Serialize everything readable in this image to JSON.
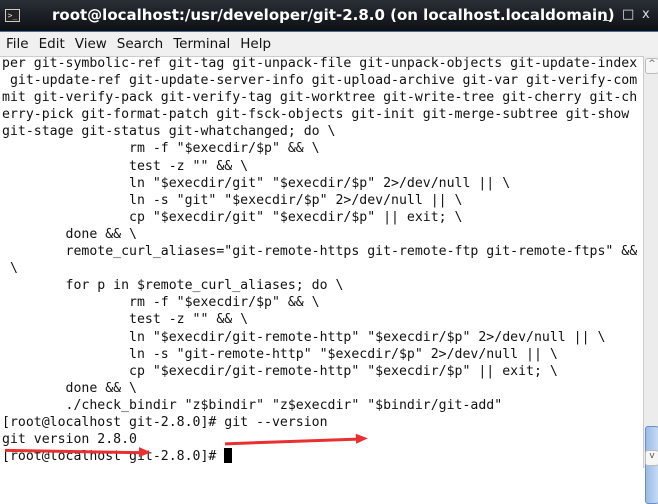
{
  "window": {
    "title": "root@localhost:/usr/developer/git-2.8.0 (on localhost.localdomain)",
    "icon": "terminal-icon",
    "controls": {
      "minimize": "_",
      "maximize": "□",
      "close": "x"
    }
  },
  "menu": [
    "File",
    "Edit",
    "View",
    "Search",
    "Terminal",
    "Help"
  ],
  "terminal": {
    "lines": [
      "per git-symbolic-ref git-tag git-unpack-file git-unpack-objects git-update-index",
      " git-update-ref git-update-server-info git-upload-archive git-var git-verify-com",
      "mit git-verify-pack git-verify-tag git-worktree git-write-tree git-cherry git-ch",
      "erry-pick git-format-patch git-fsck-objects git-init git-merge-subtree git-show",
      "git-stage git-status git-whatchanged; do \\",
      "                rm -f \"$execdir/$p\" && \\",
      "                test -z \"\" && \\",
      "                ln \"$execdir/git\" \"$execdir/$p\" 2>/dev/null || \\",
      "                ln -s \"git\" \"$execdir/$p\" 2>/dev/null || \\",
      "                cp \"$execdir/git\" \"$execdir/$p\" || exit; \\",
      "        done && \\",
      "        remote_curl_aliases=\"git-remote-https git-remote-ftp git-remote-ftps\" &&",
      " \\",
      "        for p in $remote_curl_aliases; do \\",
      "                rm -f \"$execdir/$p\" && \\",
      "                test -z \"\" && \\",
      "                ln \"$execdir/git-remote-http\" \"$execdir/$p\" 2>/dev/null || \\",
      "                ln -s \"git-remote-http\" \"$execdir/$p\" 2>/dev/null || \\",
      "                cp \"$execdir/git-remote-http\" \"$execdir/$p\" || exit; \\",
      "        done && \\",
      "        ./check_bindir \"z$bindir\" \"z$execdir\" \"$bindir/git-add\"",
      "[root@localhost git-2.8.0]# git --version",
      "git version 2.8.0"
    ],
    "prompt": "[root@localhost git-2.8.0]# "
  },
  "colors": {
    "annotation_arrow": "#e83030"
  }
}
